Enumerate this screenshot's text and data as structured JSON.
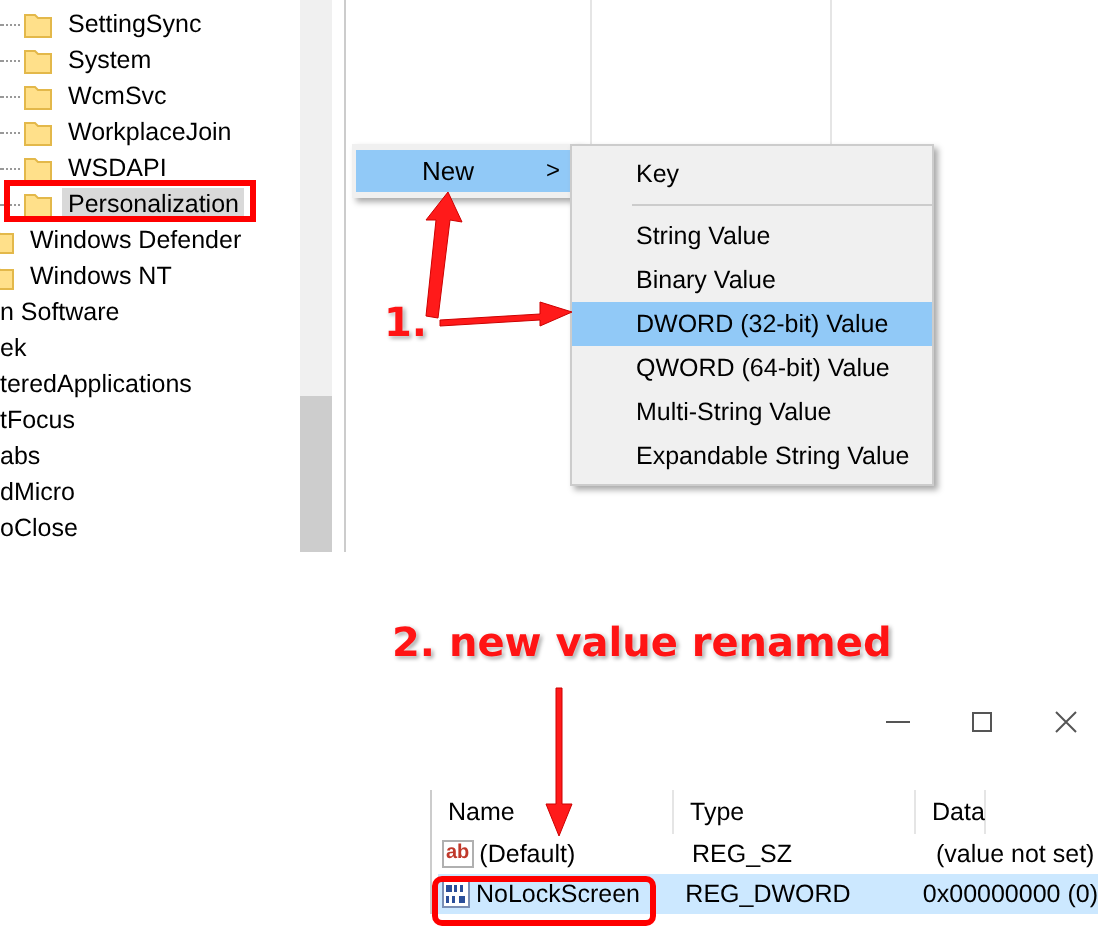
{
  "tree": [
    {
      "children": [
        {
          "children": [
            {
              "label": "SettingSync",
              "selected": false
            },
            {
              "label": "System",
              "selected": false
            },
            {
              "label": "WcmSvc",
              "selected": false
            },
            {
              "label": "WorkplaceJoin",
              "selected": false
            },
            {
              "label": "WSDAPI",
              "selected": false
            },
            {
              "label": "Personalization",
              "selected": true
            }
          ]
        },
        {
          "label": "Windows Defender",
          "selected": false
        },
        {
          "label": "Windows NT",
          "selected": false
        }
      ]
    },
    {
      "label": "n Software",
      "selected": false
    },
    {
      "label": "ek",
      "selected": false
    },
    {
      "label": "teredApplications",
      "selected": false
    },
    {
      "label": "tFocus",
      "selected": false
    },
    {
      "label": "abs",
      "selected": false
    },
    {
      "label": "dMicro",
      "selected": false
    },
    {
      "label": "oClose",
      "selected": false
    }
  ],
  "context_menu": {
    "items": [
      {
        "label": "New",
        "arrow": ">",
        "selected": true
      }
    ]
  },
  "submenu": {
    "items": [
      {
        "kind": "item",
        "label": "Key",
        "selected": false
      },
      {
        "kind": "separator"
      },
      {
        "kind": "item",
        "label": "String Value",
        "selected": false
      },
      {
        "kind": "item",
        "label": "Binary Value",
        "selected": false
      },
      {
        "kind": "item",
        "label": "DWORD (32-bit) Value",
        "selected": true
      },
      {
        "kind": "item",
        "label": "QWORD (64-bit) Value",
        "selected": false
      },
      {
        "kind": "item",
        "label": "Multi-String Value",
        "selected": false
      },
      {
        "kind": "item",
        "label": "Expandable String Value",
        "selected": false
      }
    ]
  },
  "annotations": [
    {
      "text": "1."
    },
    {
      "text": "2. new value renamed"
    }
  ],
  "table": {
    "columns": [
      "Name",
      "Type",
      "Data"
    ],
    "rows": [
      {
        "kind": "string",
        "icon_label": "ab",
        "name": "(Default)",
        "type": "REG_SZ",
        "data": "(value not set)",
        "selected": false
      },
      {
        "kind": "dword",
        "name": "NoLockScreen",
        "type": "REG_DWORD",
        "data": "0x00000000 (0)",
        "selected": true
      }
    ]
  }
}
